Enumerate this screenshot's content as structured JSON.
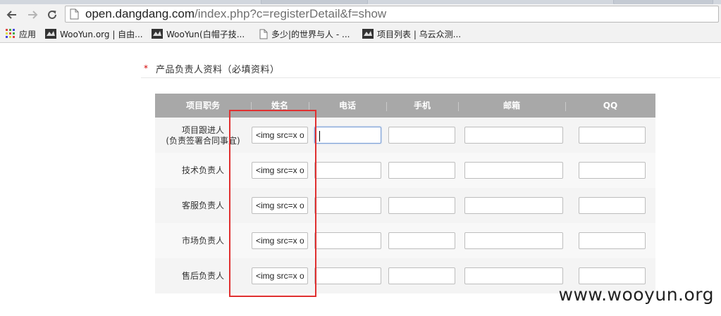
{
  "browser": {
    "url_host": "open.dangdang.com",
    "url_rest": "/index.php?c=registerDetail&f=show"
  },
  "bookmarks": [
    {
      "label": "应用",
      "icon": "apps-grid-icon"
    },
    {
      "label": "WooYun.org | 自由...",
      "icon": "wooyun-icon"
    },
    {
      "label": "WooYun(白帽子技...",
      "icon": "wooyun-icon"
    },
    {
      "label": "多少|的世界与人 - ...",
      "icon": "page-icon"
    },
    {
      "label": "项目列表 | 乌云众测...",
      "icon": "wooyun-icon"
    }
  ],
  "section": {
    "required_mark": "*",
    "title": "产品负责人资料（必填资料）"
  },
  "table": {
    "headers": [
      "项目职务",
      "姓名",
      "电话",
      "手机",
      "邮箱",
      "QQ"
    ],
    "rows": [
      {
        "role": "项目跟进人",
        "role_note": "(负责签署合同事宜)",
        "name": "<img src=x on"
      },
      {
        "role": "技术负责人",
        "name": "<img src=x on"
      },
      {
        "role": "客服负责人",
        "name": "<img src=x on"
      },
      {
        "role": "市场负责人",
        "name": "<img src=x on"
      },
      {
        "role": "售后负责人",
        "name": "<img src=x on"
      }
    ]
  },
  "annotation": {
    "highlight_color": "#e03030"
  },
  "watermark": "www.wooyun.org"
}
